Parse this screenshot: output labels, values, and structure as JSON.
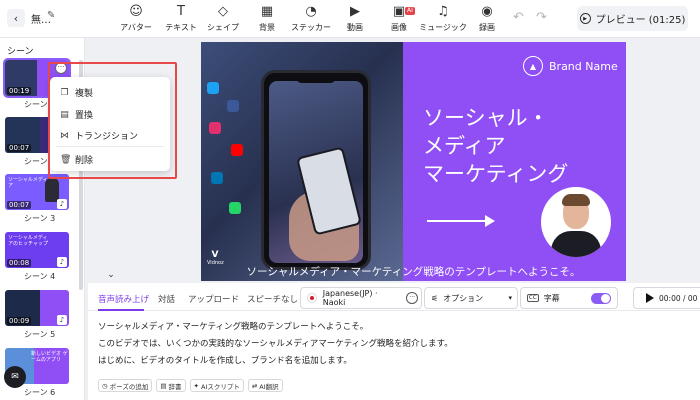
{
  "header": {
    "project_name": "無…",
    "tools": [
      {
        "label": "アバター",
        "icon": "avatar-icon"
      },
      {
        "label": "テキスト",
        "icon": "text-icon"
      },
      {
        "label": "シェイプ",
        "icon": "shape-icon"
      },
      {
        "label": "背景",
        "icon": "background-icon"
      },
      {
        "label": "ステッカー",
        "icon": "sticker-icon"
      },
      {
        "label": "動画",
        "icon": "video-icon"
      },
      {
        "label": "画像",
        "icon": "image-icon",
        "badge": "AI"
      },
      {
        "label": "ミュージック",
        "icon": "music-icon"
      },
      {
        "label": "録画",
        "icon": "record-icon"
      }
    ],
    "preview_label": "プレビュー (01:25)"
  },
  "scenes": {
    "title": "シーン",
    "items": [
      {
        "label": "シーン",
        "duration": "00:19",
        "selected": true
      },
      {
        "label": "シーン",
        "duration": "00:07"
      },
      {
        "label": "シーン 3",
        "duration": "00:07",
        "text": "ソーシャルメディア"
      },
      {
        "label": "シーン 4",
        "duration": "00:08",
        "text": "ソーシャルメディアのヒッチャップ"
      },
      {
        "label": "シーン 5",
        "duration": "00:09"
      },
      {
        "label": "シーン 6",
        "duration": "",
        "text": "新しいビデオ ゲームのアプリ"
      }
    ]
  },
  "context_menu": {
    "items": [
      {
        "label": "複製",
        "icon": "duplicate-icon"
      },
      {
        "label": "置換",
        "icon": "replace-icon"
      },
      {
        "label": "トランジション",
        "icon": "transition-icon"
      },
      {
        "label": "削除",
        "icon": "trash-icon"
      }
    ]
  },
  "canvas": {
    "brand": "Brand Name",
    "headline_lines": [
      "ソーシャル・",
      "メディア",
      "マーケティング"
    ],
    "watermark": "Vidnoz",
    "subtitle": "ソーシャルメディア・マーケティング戦略のテンプレートへようこそ。"
  },
  "editor": {
    "tabs": [
      "音声読み上げ",
      "対話",
      "アップロード",
      "スピーチなし"
    ],
    "active_tab": 0,
    "voice": "Japanese(JP) · Naoki",
    "options_label": "オプション",
    "captions_label": "字幕",
    "captions_on": true,
    "time": "00:00 / 00",
    "script_lines": [
      "ソーシャルメディア・マーケティング戦略のテンプレートへようこそ。",
      "このビデオでは、いくつかの実践的なソーシャルメディアマーケティング戦略を紹介します。",
      "はじめに、ビデオのタイトルを作成し、ブランド名を追加します。"
    ],
    "script_tools": [
      "ポーズの追加",
      "辞書",
      "AIスクリプト",
      "AI翻訳"
    ]
  },
  "colors": {
    "accent": "#8b5cf6",
    "canvas_bg": "#8f4ff5",
    "highlight": "#e84848"
  }
}
